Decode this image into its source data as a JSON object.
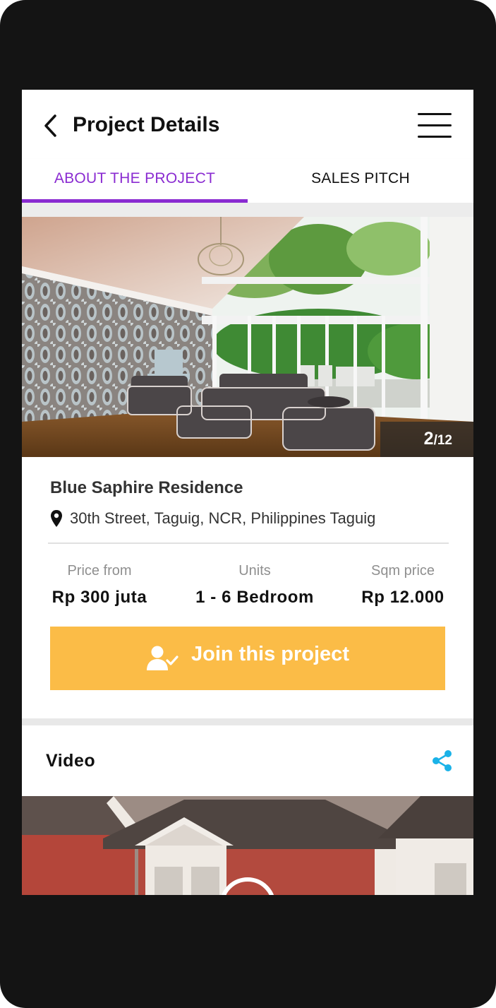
{
  "header": {
    "title": "Project Details"
  },
  "tabs": [
    {
      "label": "ABOUT THE PROJECT",
      "active": true
    },
    {
      "label": "SALES PITCH",
      "active": false
    }
  ],
  "gallery": {
    "current": "2",
    "total": "/12"
  },
  "project": {
    "name": "Blue Saphire Residence",
    "address": "30th Street, Taguig, NCR, Philippines Taguig",
    "stats": [
      {
        "label": "Price from",
        "value": "Rp 300 juta"
      },
      {
        "label": "Units",
        "value": "1 - 6 Bedroom"
      },
      {
        "label": "Sqm price",
        "value": "Rp 12.000"
      }
    ],
    "join_label": "Join this project"
  },
  "video": {
    "title": "Video"
  },
  "icons": {
    "back": "chevron-left-icon",
    "menu": "hamburger-menu-icon",
    "location": "map-pin-icon",
    "join": "user-check-icon",
    "share": "share-icon",
    "play": "play-icon"
  },
  "colors": {
    "accent": "#8a2bd1",
    "button": "#fbbc47",
    "share": "#1ab2e8",
    "device": "#141414"
  }
}
